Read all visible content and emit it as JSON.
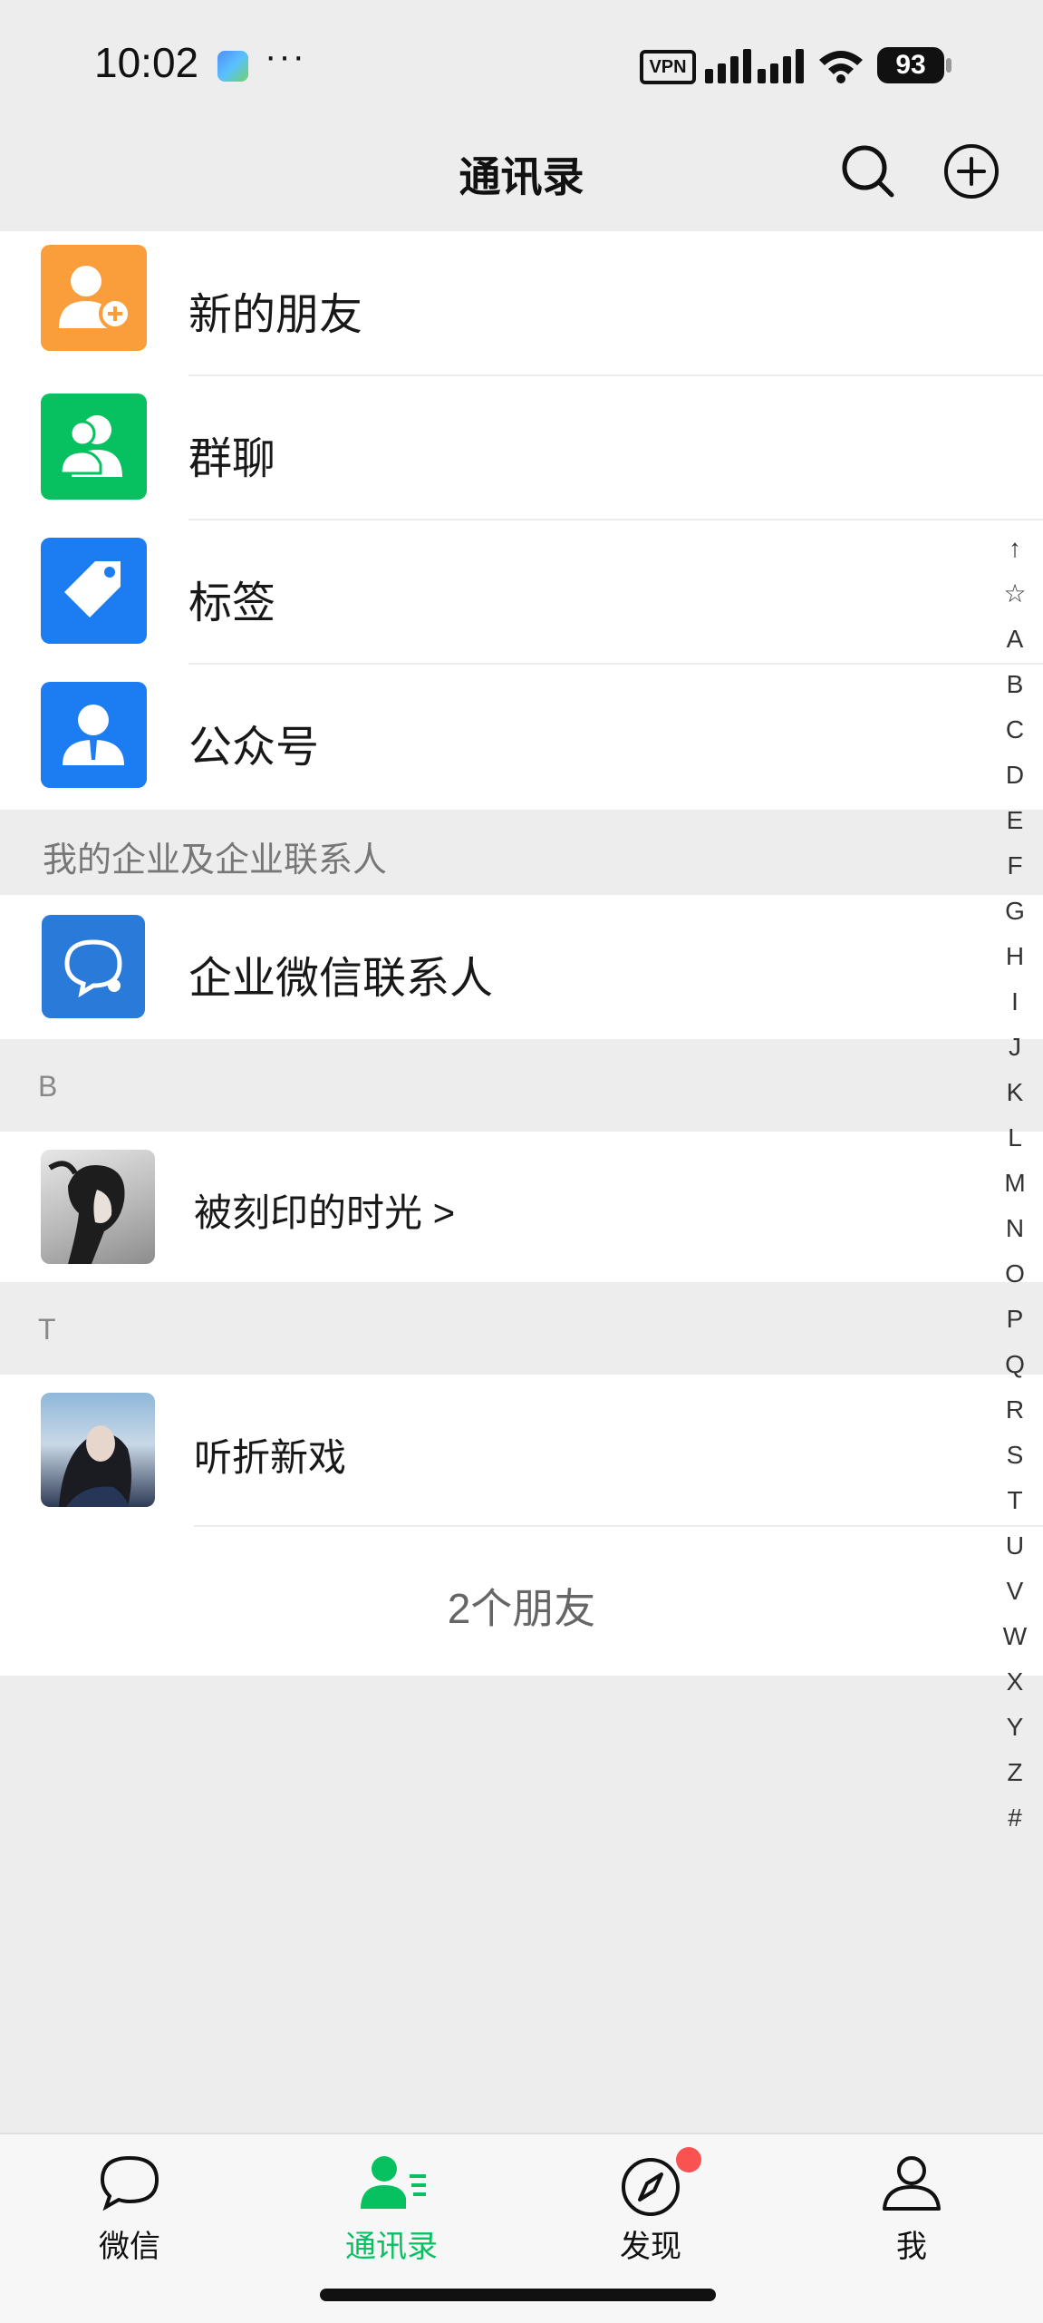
{
  "status": {
    "time": "10:02",
    "dots": "···",
    "vpn": "VPN",
    "battery": "93"
  },
  "nav": {
    "title": "通讯录"
  },
  "menu": [
    {
      "label": "新的朋友",
      "icon": "new-friend-icon",
      "color": "#fa9d3b"
    },
    {
      "label": "群聊",
      "icon": "group-chat-icon",
      "color": "#07c160"
    },
    {
      "label": "标签",
      "icon": "tag-icon",
      "color": "#1c7cf1"
    },
    {
      "label": "公众号",
      "icon": "official-account-icon",
      "color": "#1c7cf1"
    }
  ],
  "enterprise": {
    "header": "我的企业及企业联系人",
    "item_label": "企业微信联系人",
    "icon": "wecom-contact-icon",
    "color": "#2a7ad9"
  },
  "contacts": [
    {
      "group": "B",
      "name": "被刻印的时光 >"
    },
    {
      "group": "T",
      "name": "听折新戏"
    }
  ],
  "friend_count": "2个朋友",
  "index_letters": [
    "↑",
    "☆",
    "A",
    "B",
    "C",
    "D",
    "E",
    "F",
    "G",
    "H",
    "I",
    "J",
    "K",
    "L",
    "M",
    "N",
    "O",
    "P",
    "Q",
    "R",
    "S",
    "T",
    "U",
    "V",
    "W",
    "X",
    "Y",
    "Z",
    "#"
  ],
  "tabs": [
    {
      "label": "微信",
      "icon": "chat-bubble-icon",
      "active": false
    },
    {
      "label": "通讯录",
      "icon": "contacts-icon",
      "active": true
    },
    {
      "label": "发现",
      "icon": "compass-icon",
      "active": false,
      "badge": true
    },
    {
      "label": "我",
      "icon": "profile-icon",
      "active": false
    }
  ],
  "colors": {
    "accent": "#07c160",
    "badge": "#fa5151",
    "background": "#ededed"
  }
}
